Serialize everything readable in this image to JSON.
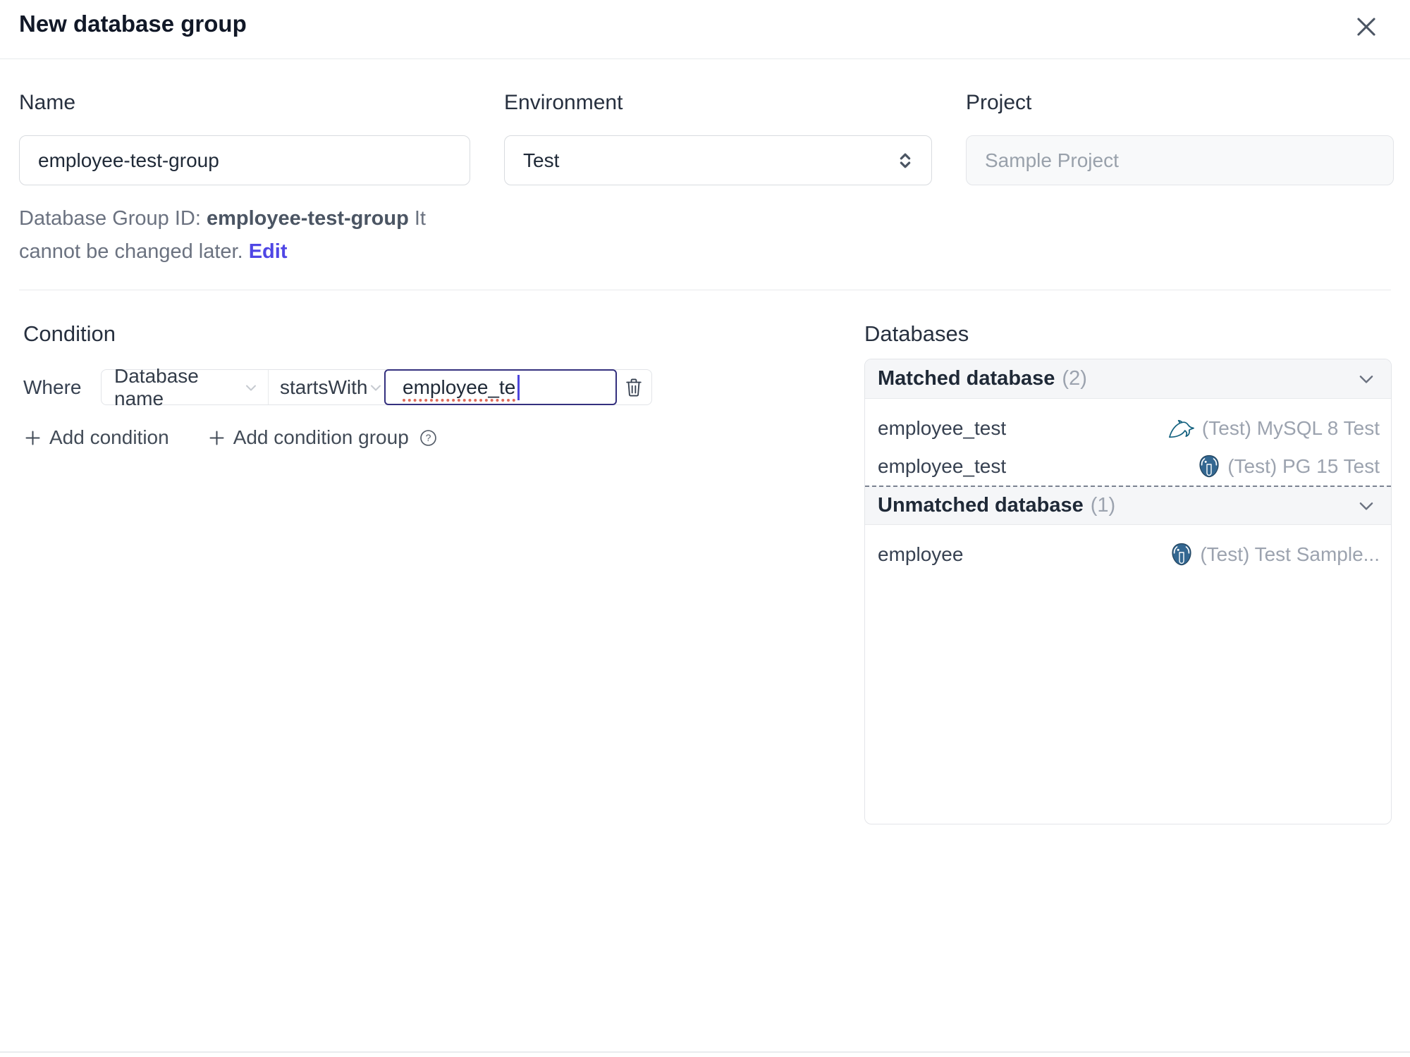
{
  "dialog": {
    "title": "New database group"
  },
  "form": {
    "name": {
      "label": "Name",
      "value": "employee-test-group"
    },
    "environment": {
      "label": "Environment",
      "value": "Test"
    },
    "project": {
      "label": "Project",
      "value": "Sample Project"
    },
    "id_hint": {
      "prefix": "Database Group ID: ",
      "id": "employee-test-group",
      "suffix": " It cannot be changed later. ",
      "edit_link": "Edit"
    }
  },
  "condition": {
    "heading": "Condition",
    "where_label": "Where",
    "factor": "Database name",
    "operator": "startsWith",
    "value": "employee_te",
    "add_condition_label": "Add condition",
    "add_condition_group_label": "Add condition group"
  },
  "databases": {
    "heading": "Databases",
    "sections": [
      {
        "title": "Matched database",
        "count": "(2)",
        "rows": [
          {
            "name": "employee_test",
            "engine": "mysql",
            "instance": "(Test) MySQL 8 Test"
          },
          {
            "name": "employee_test",
            "engine": "postgres",
            "instance": "(Test) PG 15 Test"
          }
        ]
      },
      {
        "title": "Unmatched database",
        "count": "(1)",
        "rows": [
          {
            "name": "employee",
            "engine": "postgres",
            "instance": "(Test) Test Sample..."
          }
        ]
      }
    ]
  },
  "colors": {
    "accent_indigo": "#4f46e5",
    "focus_border": "#34307e",
    "spellcheck_red": "#df6a5a",
    "header_bg": "#f5f6f8",
    "border_light": "#e3e5e9",
    "text_dark": "#1f2937",
    "text_gray": "#6b7280",
    "text_muted": "#9ca3af",
    "mysql_teal": "#13617f",
    "postgres_blue": "#336791"
  }
}
